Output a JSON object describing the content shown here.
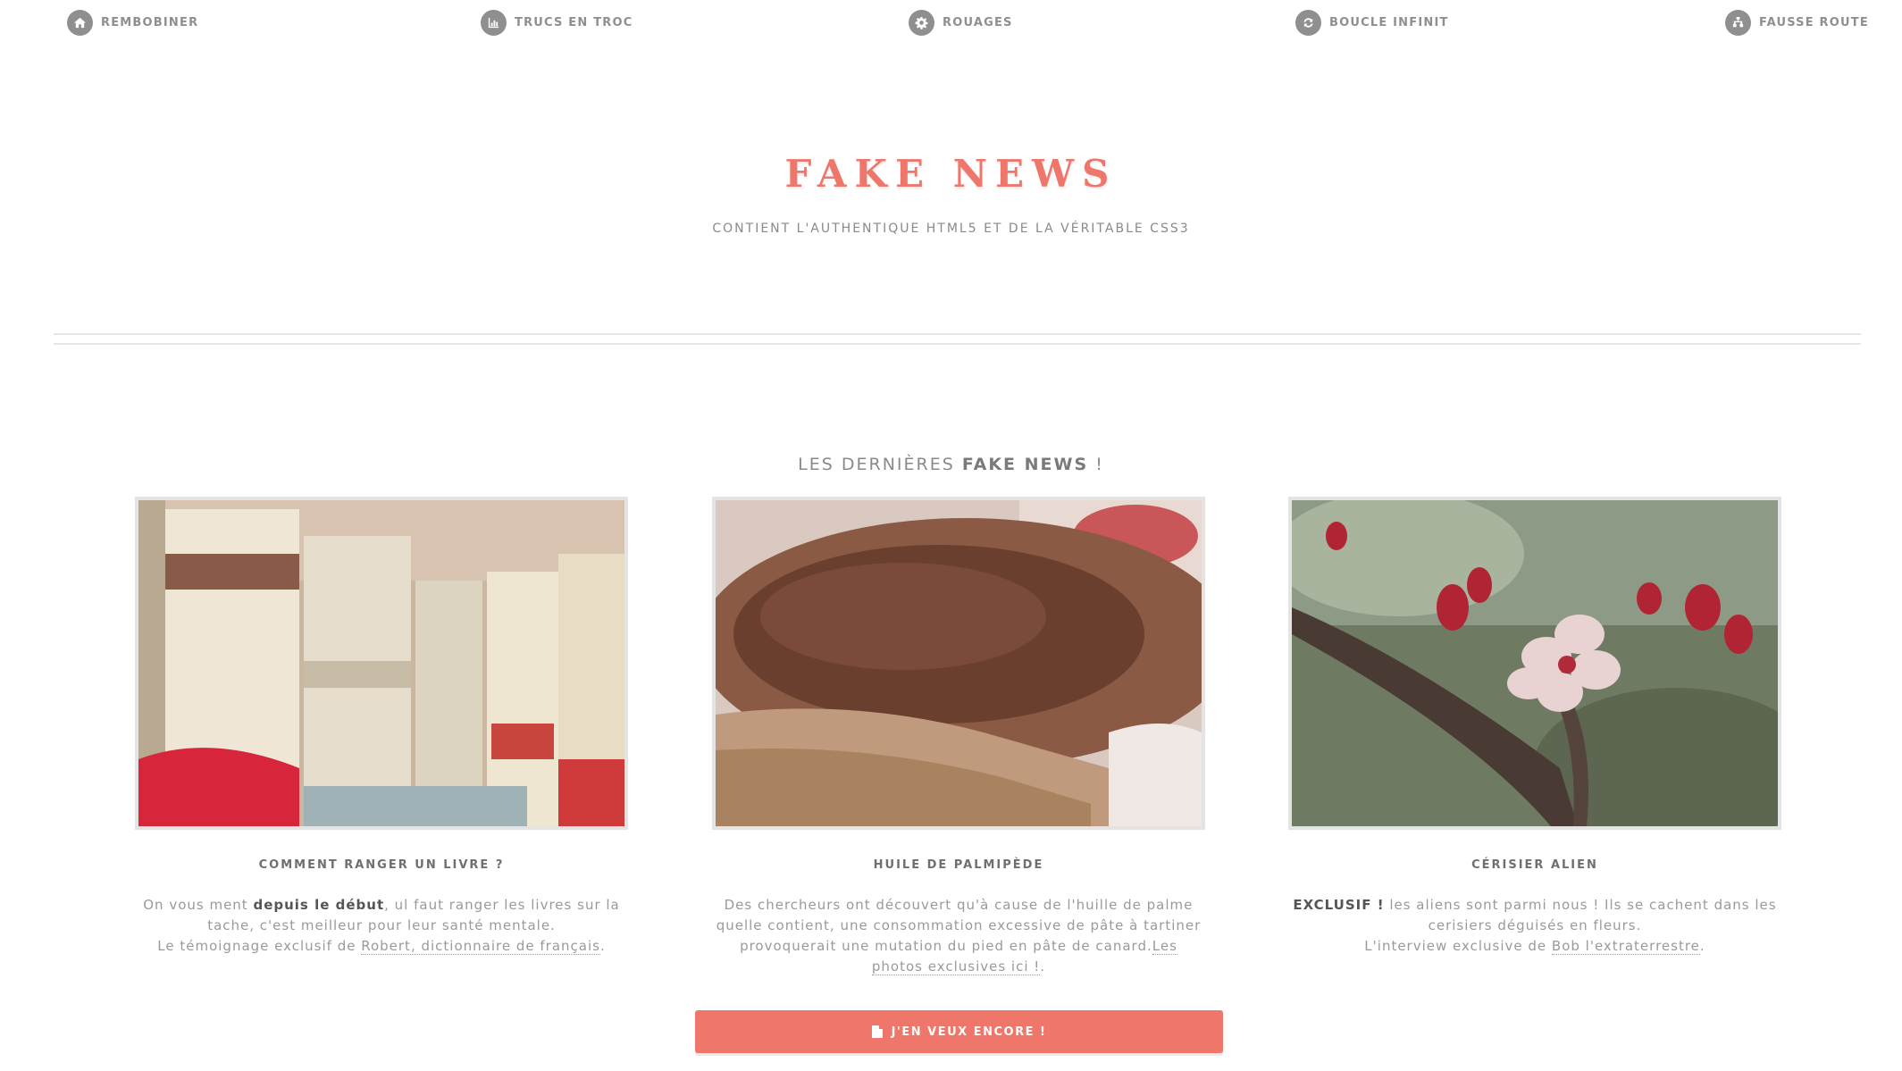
{
  "nav": {
    "items": [
      {
        "label": "REMBOBINER",
        "icon": "home-icon"
      },
      {
        "label": "TRUCS EN TROC",
        "icon": "bar-chart-icon"
      },
      {
        "label": "ROUAGES",
        "icon": "gear-icon"
      },
      {
        "label": "BOUCLE INFINIT",
        "icon": "refresh-icon"
      },
      {
        "label": "FAUSSE ROUTE",
        "icon": "sitemap-icon"
      }
    ]
  },
  "header": {
    "title": "FAKE NEWS",
    "subtitle": "CONTIENT L'AUTHENTIQUE HTML5 ET DE LA VÉRITABLE CSS3"
  },
  "section": {
    "heading_pre": "LES DERNIÈRES ",
    "heading_bold": "FAKE NEWS",
    "heading_post": " !"
  },
  "cards": [
    {
      "title": "COMMENT RANGER UN LIVRE ?",
      "text_1": "On vous ment ",
      "text_bold": "depuis le début",
      "text_2": ", ul faut ranger les livres sur la tache, c'est meilleur pour leur santé mentale.",
      "text_3": "Le témoignage exclusif de ",
      "link": "Robert, dictionnaire de français",
      "text_4": ".",
      "image": "books-photo"
    },
    {
      "title": "HUILE DE PALMIPÈDE",
      "text_1": "Des chercheurs ont découvert qu'à cause de l'huille de palme quelle contient, une consommation excessive de pâte à tartiner provoquerait une mutation du pied en pâte de canard.",
      "link": "Les photos exclusives ici !",
      "text_4": ".",
      "image": "nutella-toast-photo"
    },
    {
      "title": "CÉRISIER ALIEN",
      "text_bold": "EXCLUSIF !",
      "text_2": " les aliens sont parmi nous ! Ils se cachent dans les cerisiers déguisés en fleurs.",
      "text_3": "L'interview exclusive de ",
      "link": "Bob l'extraterrestre",
      "text_4": ".",
      "image": "cherry-blossom-photo"
    }
  ],
  "cta": {
    "label": "J'EN VEUX ENCORE !",
    "icon": "document-icon"
  },
  "colors": {
    "accent": "#ee766a",
    "text": "#8a8a8a",
    "nav_icon_bg": "#8f8f8f"
  }
}
